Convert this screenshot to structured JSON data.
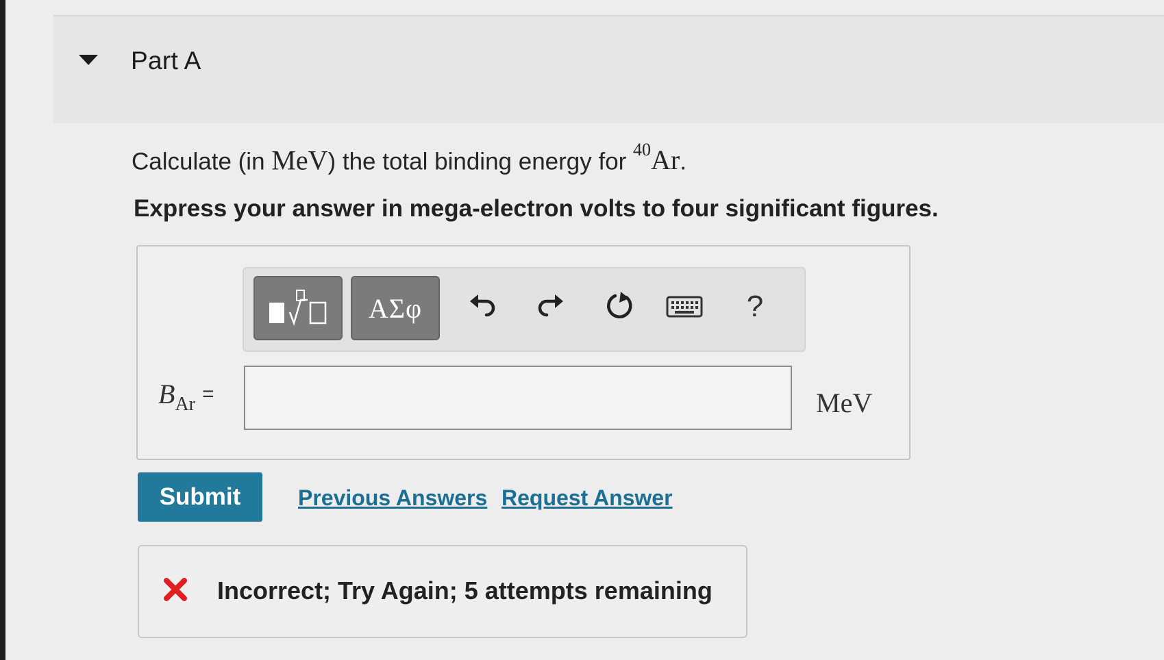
{
  "part": {
    "title": "Part A"
  },
  "question": {
    "prefix": "Calculate (in ",
    "unit": "MeV",
    "middle": ") the total binding energy for ",
    "isotope_mass": "40",
    "isotope_symbol": "Ar",
    "suffix": "."
  },
  "instruction": "Express your answer in mega-electron volts to four significant figures.",
  "toolbar": {
    "symbols_label": "ΑΣφ",
    "help_label": "?"
  },
  "answer": {
    "variable": "B",
    "subscript": "Ar",
    "equals": "=",
    "value": "",
    "unit": "MeV"
  },
  "actions": {
    "submit_label": "Submit",
    "previous_answers_label": "Previous Answers",
    "request_answer_label": "Request Answer"
  },
  "feedback": {
    "message": "Incorrect; Try Again; 5 attempts remaining",
    "status_color": "#e02020"
  },
  "colors": {
    "accent": "#217a9c",
    "link": "#1a6f92"
  }
}
